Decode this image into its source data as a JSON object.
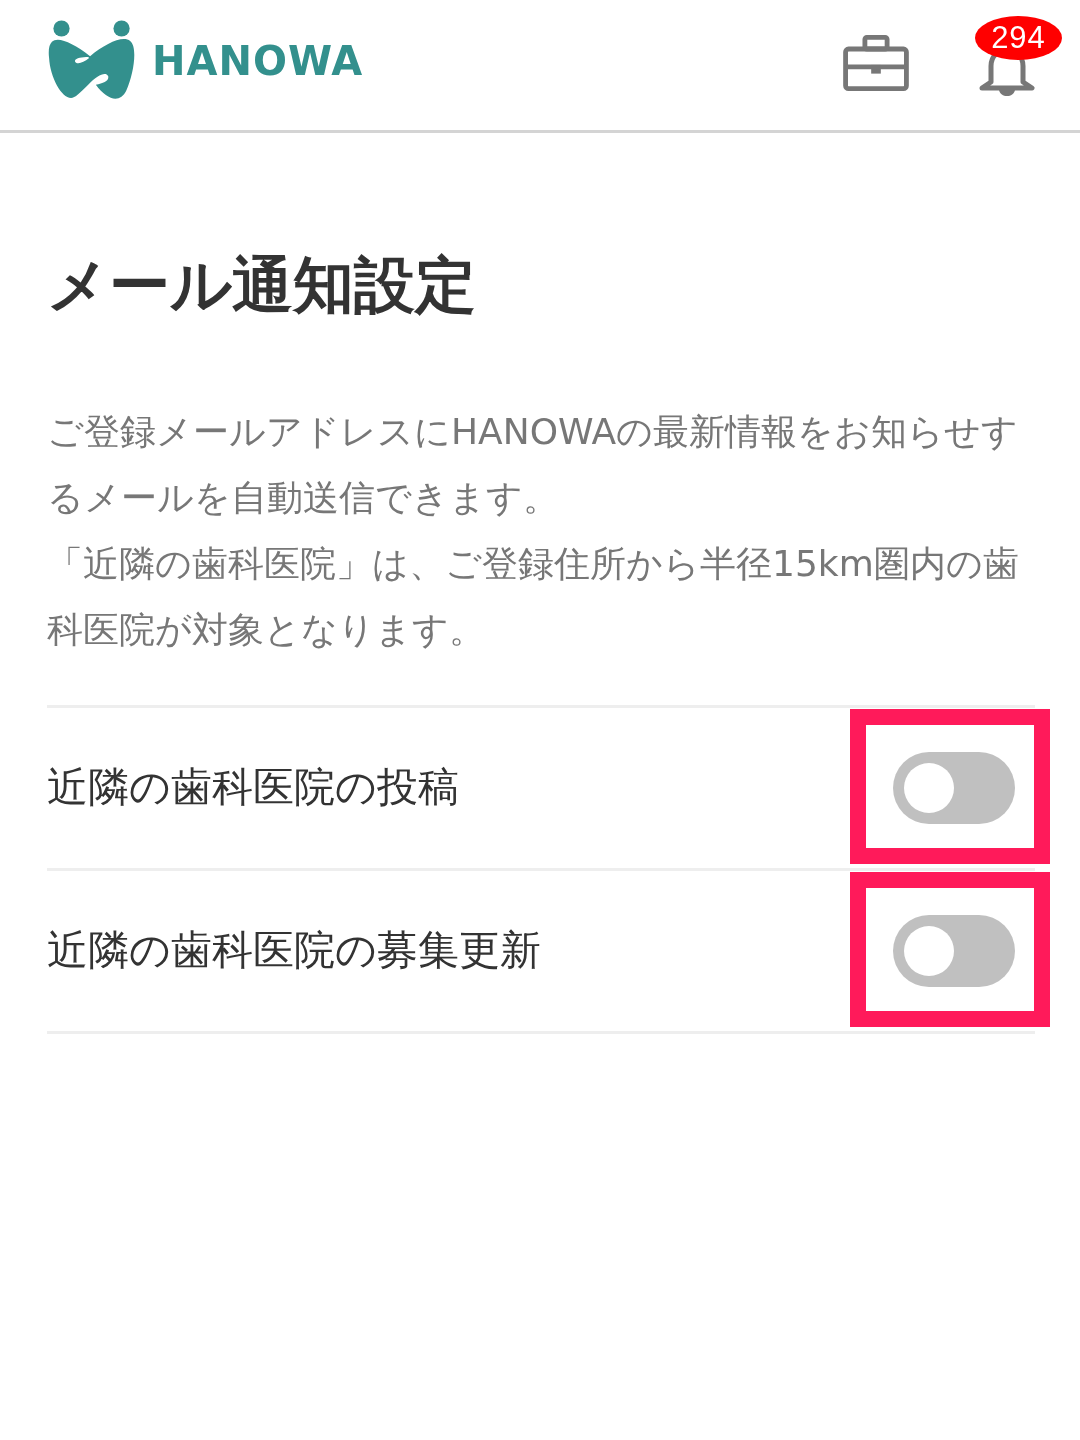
{
  "header": {
    "logo_text": "HANOWA",
    "notification_count": "294"
  },
  "page": {
    "title": "メール通知設定",
    "description": [
      "ご登録メールアドレスにHANOWAの最新情報をお知らせするメールを自動送信できます。",
      "「近隣の歯科医院」は、ご登録住所から半径15km圏内の歯科医院が対象となります。"
    ]
  },
  "settings": [
    {
      "label": "近隣の歯科医院の投稿",
      "on": false,
      "highlighted": true
    },
    {
      "label": "近隣の歯科医院の募集更新",
      "on": false,
      "highlighted": true
    }
  ]
}
